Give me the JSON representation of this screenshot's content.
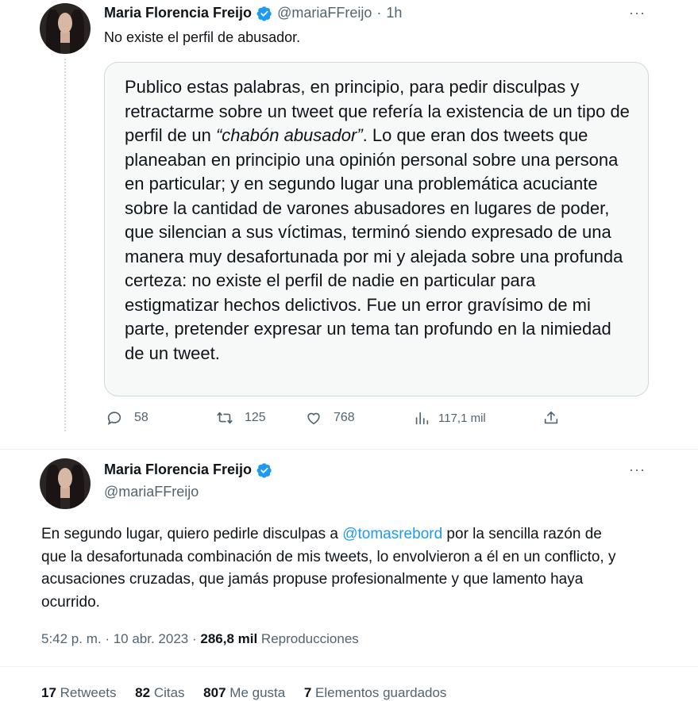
{
  "tweet1": {
    "author_name": "Maria Florencia Freijo",
    "author_handle": "@mariaFFreijo",
    "separator": "·",
    "time": "1h",
    "more": "···",
    "text": "No existe el perfil de abusador.",
    "quote": {
      "part1": "Publico estas palabras, en principio, para pedir disculpas y retractarme sobre un tweet que refería la existencia de un tipo de perfil de un ",
      "italic": "“chabón abusador”",
      "part2": ". Lo que eran dos tweets que planeaban en principio una opinión personal sobre una persona en particular; y en segundo lugar una problemática acuciante sobre la cantidad de varones abusadores en lugares de poder, que silencian a sus víctimas, terminó siendo expresado de una manera muy desafortunada por mi y alejada sobre una profunda certeza: no existe el perfil de nadie en particular para estigmatizar hechos delictivos. Fue un error gravísimo de mi parte, pretender expresar un tema tan profundo en la nimiedad de un tweet."
    },
    "actions": {
      "replies": "58",
      "retweets": "125",
      "likes": "768",
      "views": "117,1 mil"
    }
  },
  "tweet2": {
    "author_name": "Maria Florencia Freijo",
    "author_handle": "@mariaFFreijo",
    "more": "···",
    "text_before": "En segundo lugar, quiero pedirle disculpas a ",
    "mention": "@tomasrebord",
    "text_after": " por la sencilla razón de que la desafortunada combinación de mis tweets, lo envolvieron a él en un conflicto, y acusaciones cruzadas, que jamás propuse profesionalmente y que lamento haya ocurrido.",
    "timestamp": "5:42 p. m. · 10 abr. 2023 ·",
    "views_count": "286,8 mil",
    "views_label": "Reproducciones",
    "stats": {
      "retweets_count": "17",
      "retweets_label": "Retweets",
      "quotes_count": "82",
      "quotes_label": "Citas",
      "likes_count": "807",
      "likes_label": "Me gusta",
      "bookmarks_count": "7",
      "bookmarks_label": "Elementos guardados"
    }
  },
  "colors": {
    "verified": "#1d9bf0",
    "link": "#1d9bf0",
    "muted": "#536471",
    "text": "#0f1419"
  },
  "icons": [
    "verified-badge-icon",
    "more-icon",
    "reply-icon",
    "retweet-icon",
    "like-icon",
    "views-icon",
    "share-icon"
  ]
}
